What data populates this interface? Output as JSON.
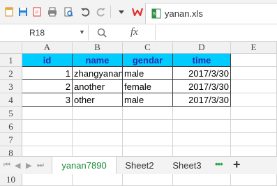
{
  "app": {
    "file_tab_name": "yanan.xls"
  },
  "formula_bar": {
    "name_box": "R18",
    "fx_label": "fx",
    "formula_value": ""
  },
  "grid": {
    "columns": [
      "A",
      "B",
      "C",
      "D",
      "E"
    ],
    "rows": [
      "1",
      "2",
      "3",
      "4",
      "5",
      "6",
      "7",
      "8",
      "9",
      "10"
    ],
    "header_row": [
      "id",
      "name",
      "gendar",
      "time"
    ],
    "data_rows": [
      [
        "1",
        "zhangyanan",
        "male",
        "2017/3/30"
      ],
      [
        "2",
        "another",
        "female",
        "2017/3/30"
      ],
      [
        "3",
        "other",
        "male",
        "2017/3/30"
      ]
    ],
    "header_fill": "#00CCFF",
    "header_text_color": "#2A2AA8"
  },
  "sheets": {
    "tabs": [
      "yanan7890",
      "Sheet2",
      "Sheet3"
    ],
    "active": "yanan7890",
    "more_label": "•••",
    "add_label": "+"
  },
  "colors": {
    "wps_red": "#E0312B",
    "active_sheet_text": "#1A8A3A"
  }
}
